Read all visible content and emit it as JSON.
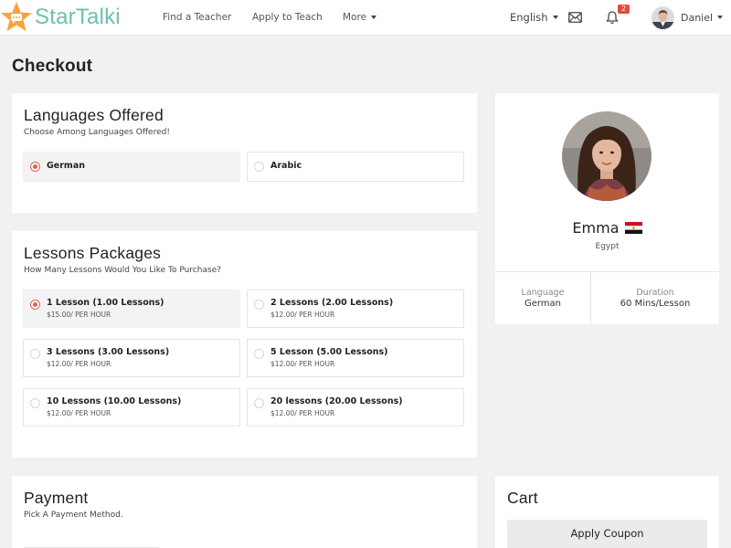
{
  "brand": {
    "name": "StarTalki",
    "accent": "#6cc0b0",
    "star_color": "#f6a43a"
  },
  "nav": {
    "find_teacher": "Find a Teacher",
    "apply_teach": "Apply to Teach",
    "more": "More",
    "language": "English",
    "notifications_count": "2",
    "user_name": "Daniel",
    "mail_icon": "envelope-icon",
    "bell_icon": "bell-icon"
  },
  "page": {
    "title": "Checkout"
  },
  "languages": {
    "title": "Languages Offered",
    "subtitle": "Choose Among Languages Offered!",
    "options": [
      {
        "label": "German",
        "selected": true
      },
      {
        "label": "Arabic",
        "selected": false
      }
    ]
  },
  "packages": {
    "title": "Lessons Packages",
    "subtitle": "How Many Lessons Would You Like To Purchase?",
    "options": [
      {
        "label": "1 Lesson (1.00 Lessons)",
        "price": "$15.00/ PER HOUR",
        "selected": true
      },
      {
        "label": "2 Lessons (2.00 Lessons)",
        "price": "$12.00/ PER HOUR",
        "selected": false
      },
      {
        "label": "3 Lessons (3.00 Lessons)",
        "price": "$12.00/ PER HOUR",
        "selected": false
      },
      {
        "label": "5 Lesson (5.00 Lessons)",
        "price": "$12.00/ PER HOUR",
        "selected": false
      },
      {
        "label": "10 Lessons (10.00 Lessons)",
        "price": "$12.00/ PER HOUR",
        "selected": false
      },
      {
        "label": "20 lessons (20.00 Lessons)",
        "price": "$12.00/ PER HOUR",
        "selected": false
      }
    ]
  },
  "payment": {
    "title": "Payment",
    "subtitle": "Pick A Payment Method."
  },
  "teacher": {
    "name": "Emma",
    "country": "Egypt",
    "flag_icon": "egypt-flag-icon",
    "language_label": "Language",
    "language_value": "German",
    "duration_label": "Duration",
    "duration_value": "60 Mins/Lesson"
  },
  "cart": {
    "title": "Cart",
    "coupon_button": "Apply Coupon"
  },
  "colors": {
    "radio_selected": "#e0604c",
    "badge": "#e04b3b",
    "page_bg": "#f1f1f1"
  }
}
